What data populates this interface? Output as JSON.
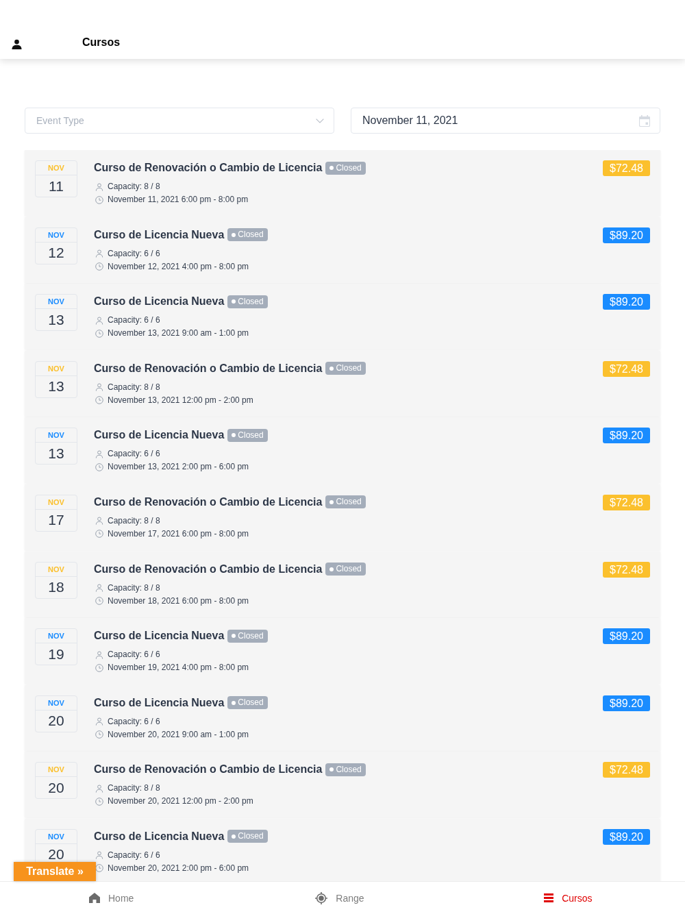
{
  "header": {
    "title": "Cursos"
  },
  "filters": {
    "event_type": {
      "placeholder": "Event Type"
    },
    "date": {
      "value": "November 11, 2021"
    }
  },
  "events": [
    {
      "month": "NOV",
      "day": "11",
      "title": "Curso de Renovación o Cambio de Licencia",
      "status": "Closed",
      "capacity": "Capacity: 8 / 8",
      "time": "November 11, 2021 6:00 pm - 8:00 pm",
      "price": "$72.48",
      "color": "#fbc02d"
    },
    {
      "month": "NOV",
      "day": "12",
      "title": "Curso de Licencia Nueva",
      "status": "Closed",
      "capacity": "Capacity: 6 / 6",
      "time": "November 12, 2021 4:00 pm - 8:00 pm",
      "price": "$89.20",
      "color": "#1a8cff"
    },
    {
      "month": "NOV",
      "day": "13",
      "title": "Curso de Licencia Nueva",
      "status": "Closed",
      "capacity": "Capacity: 6 / 6",
      "time": "November 13, 2021 9:00 am - 1:00 pm",
      "price": "$89.20",
      "color": "#1a8cff"
    },
    {
      "month": "NOV",
      "day": "13",
      "title": "Curso de Renovación o Cambio de Licencia",
      "status": "Closed",
      "capacity": "Capacity: 8 / 8",
      "time": "November 13, 2021 12:00 pm - 2:00 pm",
      "price": "$72.48",
      "color": "#fbc02d"
    },
    {
      "month": "NOV",
      "day": "13",
      "title": "Curso de Licencia Nueva",
      "status": "Closed",
      "capacity": "Capacity: 6 / 6",
      "time": "November 13, 2021 2:00 pm - 6:00 pm",
      "price": "$89.20",
      "color": "#1a8cff"
    },
    {
      "month": "NOV",
      "day": "17",
      "title": "Curso de Renovación o Cambio de Licencia",
      "status": "Closed",
      "capacity": "Capacity: 8 / 8",
      "time": "November 17, 2021 6:00 pm - 8:00 pm",
      "price": "$72.48",
      "color": "#fbc02d"
    },
    {
      "month": "NOV",
      "day": "18",
      "title": "Curso de Renovación o Cambio de Licencia",
      "status": "Closed",
      "capacity": "Capacity: 8 / 8",
      "time": "November 18, 2021 6:00 pm - 8:00 pm",
      "price": "$72.48",
      "color": "#fbc02d"
    },
    {
      "month": "NOV",
      "day": "19",
      "title": "Curso de Licencia Nueva",
      "status": "Closed",
      "capacity": "Capacity: 6 / 6",
      "time": "November 19, 2021 4:00 pm - 8:00 pm",
      "price": "$89.20",
      "color": "#1a8cff"
    },
    {
      "month": "NOV",
      "day": "20",
      "title": "Curso de Licencia Nueva",
      "status": "Closed",
      "capacity": "Capacity: 6 / 6",
      "time": "November 20, 2021 9:00 am - 1:00 pm",
      "price": "$89.20",
      "color": "#1a8cff"
    },
    {
      "month": "NOV",
      "day": "20",
      "title": "Curso de Renovación o Cambio de Licencia",
      "status": "Closed",
      "capacity": "Capacity: 8 / 8",
      "time": "November 20, 2021 12:00 pm - 2:00 pm",
      "price": "$72.48",
      "color": "#fbc02d"
    },
    {
      "month": "NOV",
      "day": "20",
      "title": "Curso de Licencia Nueva",
      "status": "Closed",
      "capacity": "Capacity: 6 / 6",
      "time": "November 20, 2021 2:00 pm - 6:00 pm",
      "price": "$89.20",
      "color": "#1a8cff"
    }
  ],
  "translate_button": {
    "label": "Translate »"
  },
  "bottom_nav": {
    "items": [
      {
        "label": "Home",
        "kind": "home",
        "selected": false
      },
      {
        "label": "Range",
        "kind": "target",
        "selected": false
      },
      {
        "label": "Cursos",
        "kind": "menu",
        "selected": true
      }
    ]
  }
}
